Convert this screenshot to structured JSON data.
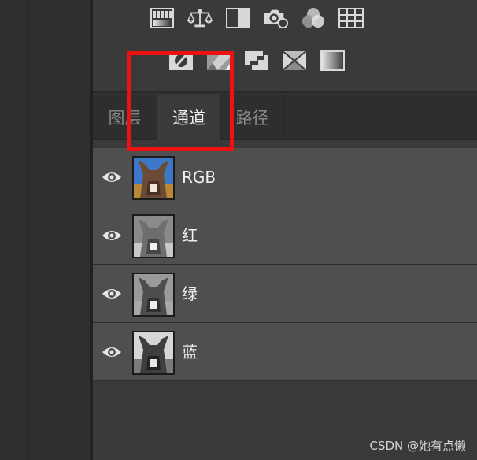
{
  "adjustment_icons": {
    "row1": [
      "brightness-contrast-icon",
      "levels-icon",
      "exposure-icon",
      "photo-filter-icon",
      "channel-mixer-icon",
      "color-lookup-grid-icon"
    ],
    "row2": [
      "invert-icon",
      "posterize-icon",
      "threshold-icon",
      "selective-color-icon",
      "gradient-map-icon"
    ]
  },
  "tabs": [
    {
      "label": "图层",
      "active": false
    },
    {
      "label": "通道",
      "active": true
    },
    {
      "label": "路径",
      "active": false
    }
  ],
  "channels": [
    {
      "label": "RGB",
      "visible": true,
      "thumb": "color"
    },
    {
      "label": "红",
      "visible": true,
      "thumb": "gray-light"
    },
    {
      "label": "绿",
      "visible": true,
      "thumb": "gray-mid"
    },
    {
      "label": "蓝",
      "visible": true,
      "thumb": "gray-dark"
    }
  ],
  "highlight": {
    "color": "#ee1111"
  },
  "watermark": "CSDN @她有点懒"
}
